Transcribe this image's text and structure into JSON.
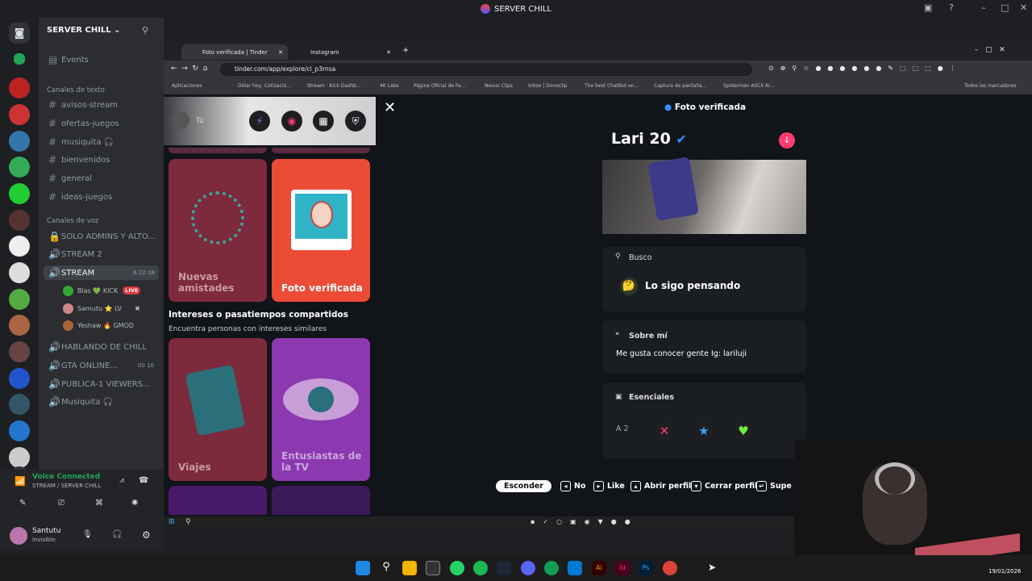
{
  "app": {
    "title": "SERVER CHILL"
  },
  "discord": {
    "server_name": "SERVER CHILL",
    "events_label": "Events",
    "text_category": "Canales de texto",
    "text_channels": [
      "avisos-stream",
      "ofertas-juegos",
      "musiquita 🎧",
      "bienvenidos",
      "general",
      "ideas-juegos"
    ],
    "voice_category": "Canales de voz",
    "voice_channels": [
      "SOLO ADMINS Y ALTO...",
      "STREAM 2",
      "STREAM",
      "HABLANDO DE CHILL",
      "GTA ONLINE...",
      "PUBLICA-1 VIEWERS...",
      "Musiquita 🎧"
    ],
    "stream_time": "6:22:18",
    "gta_counts": [
      "00",
      "10"
    ],
    "voice_users": [
      {
        "name": "Blas 💚 KICK",
        "badge": "LIVE"
      },
      {
        "name": "Samutu ⭐ LV",
        "badge": ""
      },
      {
        "name": "Yeshaw 🔥 GMOD",
        "badge": ""
      }
    ],
    "voice_status": "Voice Connected",
    "voice_channel_path": "STREAM / SERVER CHILL",
    "user_name": "Santutu",
    "user_status": "Invisible"
  },
  "browser": {
    "tabs": [
      "Foto verificada | Tinder",
      "Instagram"
    ],
    "url": "tinder.com/app/explore/cl_p3rnsa",
    "bookmarks": [
      "Aplicaciones",
      "Dólar hoy, Cotizació...",
      "Stream · Kick Dashb...",
      "4K Labs",
      "Página Oficial de Fa...",
      "Nexus Clips",
      "Inbox | Donoclip",
      "The best ChatBot on...",
      "Captura de pantalla...",
      "Spiderman ASCII Ar..."
    ],
    "all_bookmarks": "Todos los marcadores"
  },
  "tinder": {
    "user_label": "Tú",
    "cards": [
      {
        "label": "Nuevas amistades",
        "color": "#7d2a3c"
      },
      {
        "label": "Foto verificada",
        "color": "#ec4b36"
      },
      {
        "label": "Viajes",
        "color": "#7d2a3c"
      },
      {
        "label": "Entusiastas de la TV",
        "color": "#8c38b0"
      }
    ],
    "section_title": "Intereses o pasatiempos compartidos",
    "section_subtitle": "Encuentra personas con intereses similares",
    "header_badge": "Foto verificada",
    "profile_name": "Lari 20",
    "busco_label": "Busco",
    "busco_value": "Lo sigo pensando",
    "about_label": "Sobre mí",
    "about_text": "Me gusta conocer gente Ig: lariluji",
    "essentials_label": "Esenciales",
    "distance_partial": "A 2",
    "shortcuts": [
      "Esconder",
      "No",
      "Like",
      "Abrir perfil",
      "Cerrar perfil",
      "Supe"
    ]
  },
  "taskbar": {
    "date": "19/01/2026"
  },
  "colors": {
    "accent": "#fe3c72",
    "discord_bg": "#2b2d31",
    "live": "#da373c"
  }
}
